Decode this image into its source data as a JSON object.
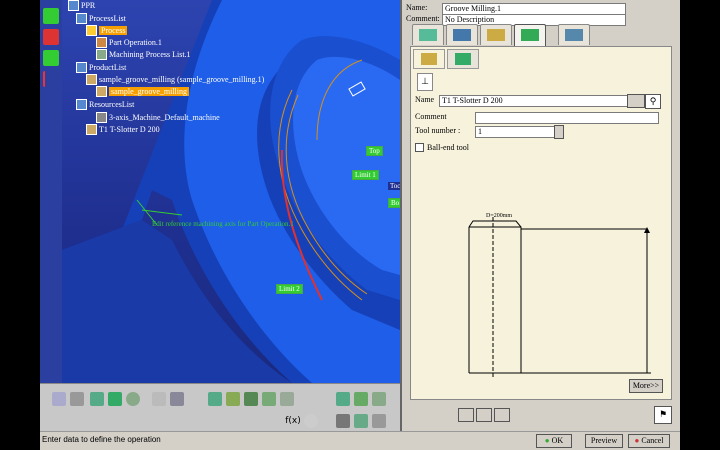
{
  "tree": {
    "root": "PPR",
    "process_list": "ProcessList",
    "process": "Process",
    "part_operation": "Part Operation.1",
    "machining_process_list": "Machining Process List.1",
    "product_list": "ProductList",
    "product_item": "sample_groove_milling (sample_groove_milling.1)",
    "product_selected": "sample_groove_milling",
    "resources_list": "ResourcesList",
    "machine": "3-axis_Machine_Default_machine",
    "tool": "T1 T-Slotter D 200"
  },
  "viewport": {
    "labels": {
      "top": "Top",
      "limit1": "Limit 1",
      "limit2": "Limit 2",
      "tool_label": "Toc",
      "bottom": "Bo"
    },
    "message": "Edit reference machining axis for Part Operation.1",
    "colors": {
      "part_blue": "#1e5ee8",
      "part_dark": "#1640b8",
      "highlight_green": "#33cc33",
      "edge_orange": "#d4901c"
    }
  },
  "dialog": {
    "name_label": "Name:",
    "name_value": "Groove Milling.1",
    "comment_label": "Comment:",
    "comment_value": "No Description",
    "tool_name_label": "Name",
    "tool_name_value": "T1 T-Slotter D 200",
    "comment2_label": "Comment",
    "comment2_value": "",
    "tool_number_label": "Tool number :",
    "tool_number_value": "1",
    "ball_end_label": "Ball-end tool",
    "diameter_label": "D=200mm",
    "more_button": "More>>",
    "ok_button": "OK",
    "preview_button": "Preview",
    "cancel_button": "Cancel"
  },
  "status": {
    "text": "Enter data to define the operation"
  }
}
